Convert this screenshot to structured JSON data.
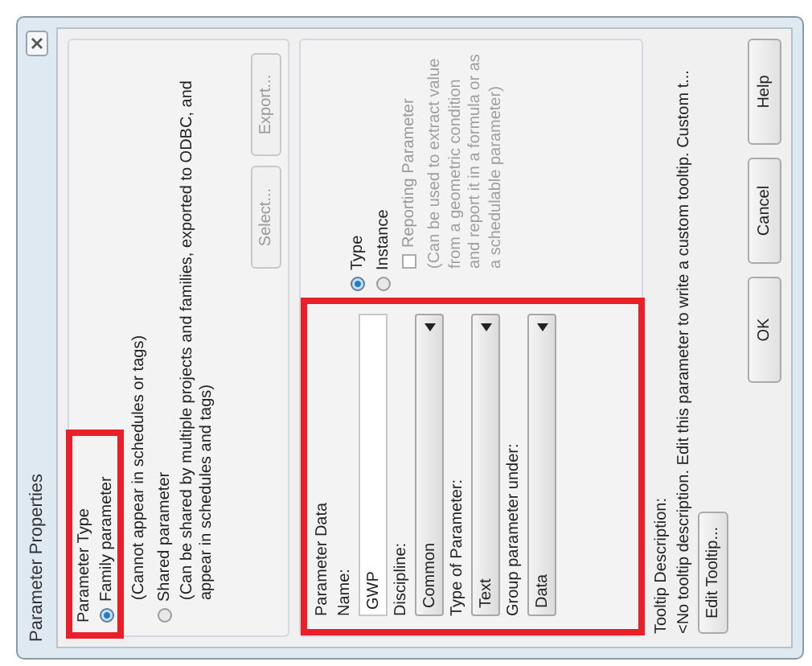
{
  "window": {
    "title": "Parameter Properties"
  },
  "parameter_type": {
    "label": "Parameter Type",
    "options": [
      {
        "label": "Family parameter",
        "note": "(Cannot appear in schedules or tags)",
        "selected": true
      },
      {
        "label": "Shared parameter",
        "note": "(Can be shared by multiple projects and families, exported to ODBC, and appear in schedules and tags)",
        "selected": false
      }
    ],
    "buttons": [
      {
        "label": "Select...",
        "disabled": true
      },
      {
        "label": "Export...",
        "disabled": true
      }
    ]
  },
  "parameter_data": {
    "label": "Parameter Data",
    "name": {
      "label": "Name:",
      "value": "GWP"
    },
    "dropdowns": [
      {
        "label": "Discipline:",
        "value": "Common"
      },
      {
        "label": "Type of Parameter:",
        "value": "Text"
      },
      {
        "label": "Group parameter under:",
        "value": "Data"
      }
    ],
    "scope": [
      {
        "label": "Type",
        "selected": true
      },
      {
        "label": "Instance",
        "selected": false
      }
    ],
    "reporting": {
      "label": "Reporting Parameter",
      "checked": false,
      "disabled": true,
      "note": "(Can be used to extract value from a geometric condition and report it in a formula or as a schedulable parameter)"
    }
  },
  "tooltip": {
    "label": "Tooltip Description:",
    "text": "<No tooltip description. Edit this parameter to write a custom tooltip. Custom t...",
    "button": "Edit Tooltip..."
  },
  "buttons": [
    "OK",
    "Cancel",
    "Help"
  ]
}
